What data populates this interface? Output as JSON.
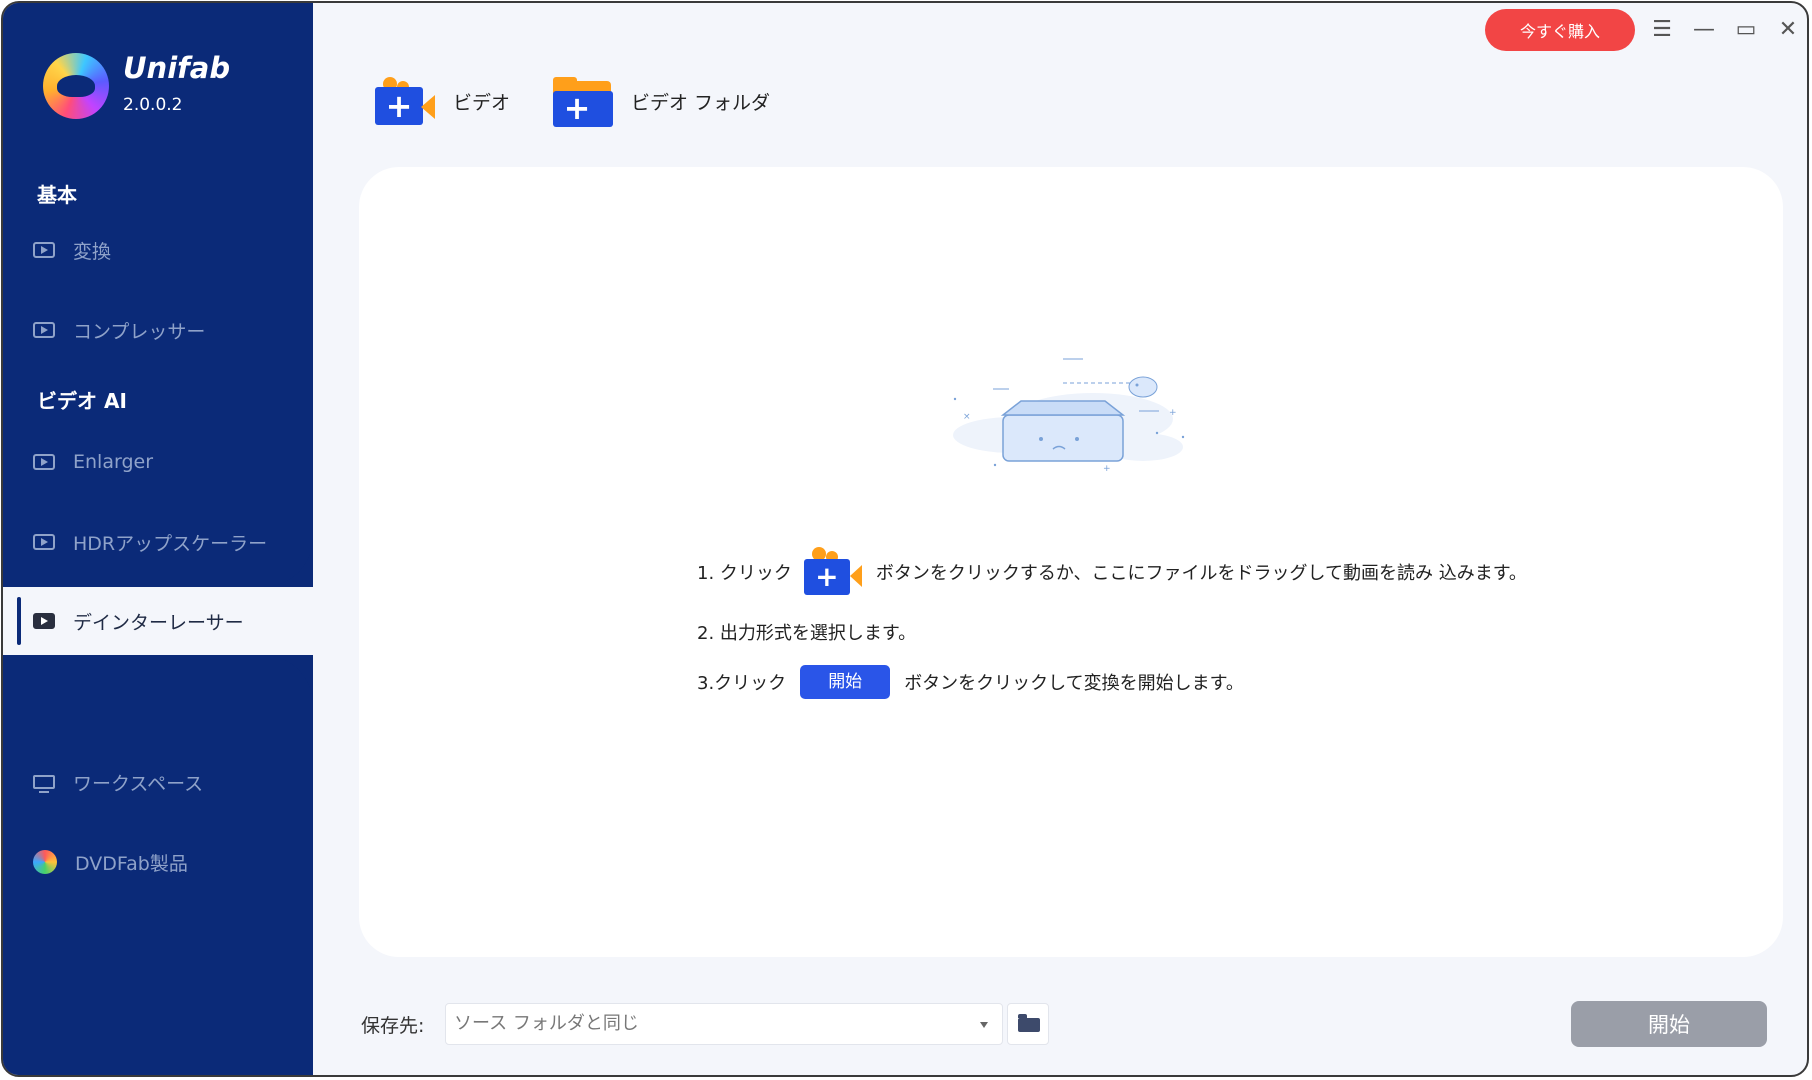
{
  "app": {
    "name": "Unifab",
    "version": "2.0.0.2"
  },
  "titlebar": {
    "buy_label": "今すぐ購入",
    "menu_glyph": "☰",
    "minimize_glyph": "—",
    "maximize_glyph": "▭",
    "close_glyph": "✕"
  },
  "sidebar": {
    "section_basic": "基本",
    "section_ai": "ビデオ AI",
    "items": [
      {
        "label": "変換",
        "icon": "video-play-icon"
      },
      {
        "label": "コンプレッサー",
        "icon": "compress-icon"
      },
      {
        "label": "Enlarger",
        "icon": "enlarge-icon"
      },
      {
        "label": "HDRアップスケーラー",
        "icon": "hdr-icon"
      },
      {
        "label": "デインターレーサー",
        "icon": "deinterlace-icon",
        "active": true
      },
      {
        "label": "ワークスペース",
        "icon": "monitor-icon"
      },
      {
        "label": "DVDFab製品",
        "icon": "dvdfab-icon"
      }
    ]
  },
  "toolbar": {
    "add_video_label": "ビデオ",
    "add_folder_label": "ビデオ フォルダ"
  },
  "instructions": {
    "step1_prefix": "1. クリック",
    "step1_suffix": "ボタンをクリックするか、ここにファイルをドラッグして動画を読み 込みます。",
    "step2": "2. 出力形式を選択します。",
    "step3_prefix": "3.クリック",
    "step3_button": "開始",
    "step3_suffix": "ボタンをクリックして変換を開始します。"
  },
  "bottom": {
    "save_label": "保存先:",
    "save_value": "ソース フォルダと同じ",
    "start_label": "開始"
  },
  "colors": {
    "sidebar": "#0b2a78",
    "buy": "#f24545",
    "accent": "#2a55e8",
    "start_disabled": "#9a9ea8"
  }
}
